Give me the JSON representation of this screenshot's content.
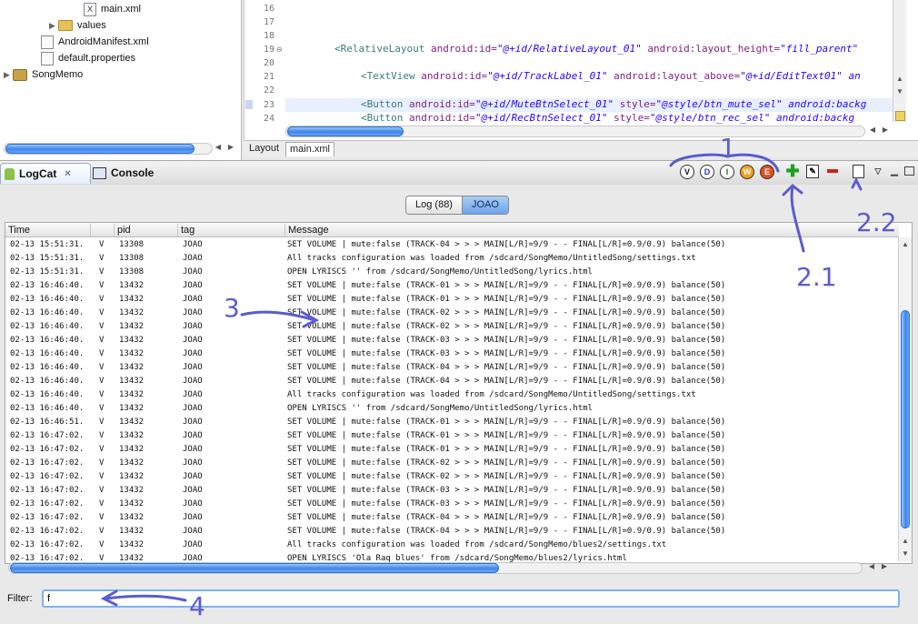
{
  "tree": {
    "items": [
      {
        "label": "main.xml",
        "kind": "file"
      },
      {
        "label": "values",
        "kind": "folder"
      },
      {
        "label": "AndroidManifest.xml",
        "kind": "file"
      },
      {
        "label": "default.properties",
        "kind": "file"
      },
      {
        "label": "SongMemo",
        "kind": "project"
      }
    ]
  },
  "editor": {
    "lines": [
      {
        "num": "16",
        "code": ""
      },
      {
        "num": "17",
        "code": ""
      },
      {
        "num": "18",
        "code": ""
      },
      {
        "num": "19",
        "tag": "<RelativeLayout",
        "a1": " android:id=",
        "v1": "\"@+id/RelativeLayout_01\"",
        "a2": " android:layout_height=",
        "v2": "\"fill_parent\""
      },
      {
        "num": "20",
        "code": ""
      },
      {
        "num": "21",
        "tag": "<TextView",
        "a1": " android:id=",
        "v1": "\"@+id/TrackLabel_01\"",
        "a2": " android:layout_above=",
        "v2": "\"@+id/EditText01\" an"
      },
      {
        "num": "22",
        "code": ""
      },
      {
        "num": "23",
        "tag": "<Button",
        "a1": " android:id=",
        "v1": "\"@+id/MuteBtnSelect_01\"",
        "a2": " style=",
        "v2": "\"@style/btn_mute_sel\" android:backg"
      },
      {
        "num": "24",
        "tag": "<Button",
        "a1": " android:id=",
        "v1": "\"@+id/RecBtnSelect_01\"",
        "a2": "  style=",
        "v2": "\"@style/btn_rec_sel\"  android:backg"
      }
    ],
    "tabs": [
      "Layout",
      "main.xml"
    ]
  },
  "views": {
    "logcat_tab": "LogCat",
    "console_tab": "Console",
    "levels": [
      "V",
      "D",
      "I",
      "W",
      "E"
    ]
  },
  "segments": {
    "log": "Log (88)",
    "joao": "JOAO"
  },
  "table": {
    "headers": [
      "Time",
      "",
      "pid",
      "tag",
      "Message"
    ],
    "rows": [
      [
        "02-13 15:51:31.",
        "V",
        "13308",
        "JOAO",
        "SET VOLUME | mute:false (TRACK-04 > > > MAIN[L/R]=9/9 - - FINAL[L/R]=0.9/0.9) balance(50)"
      ],
      [
        "02-13 15:51:31.",
        "V",
        "13308",
        "JOAO",
        "All tracks configuration was loaded from /sdcard/SongMemo/UntitledSong/settings.txt"
      ],
      [
        "02-13 15:51:31.",
        "V",
        "13308",
        "JOAO",
        "OPEN LYRISCS '' from /sdcard/SongMemo/UntitledSong/lyrics.html"
      ],
      [
        "02-13 16:46:40.",
        "V",
        "13432",
        "JOAO",
        "SET VOLUME | mute:false (TRACK-01 > > > MAIN[L/R]=9/9 - - FINAL[L/R]=0.9/0.9) balance(50)"
      ],
      [
        "02-13 16:46:40.",
        "V",
        "13432",
        "JOAO",
        "SET VOLUME | mute:false (TRACK-01 > > > MAIN[L/R]=9/9 - - FINAL[L/R]=0.9/0.9) balance(50)"
      ],
      [
        "02-13 16:46:40.",
        "V",
        "13432",
        "JOAO",
        "SET VOLUME | mute:false (TRACK-02 > > > MAIN[L/R]=9/9 - - FINAL[L/R]=0.9/0.9) balance(50)"
      ],
      [
        "02-13 16:46:40.",
        "V",
        "13432",
        "JOAO",
        "SET VOLUME | mute:false (TRACK-02 > > > MAIN[L/R]=9/9 - - FINAL[L/R]=0.9/0.9) balance(50)"
      ],
      [
        "02-13 16:46:40.",
        "V",
        "13432",
        "JOAO",
        "SET VOLUME | mute:false (TRACK-03 > > > MAIN[L/R]=9/9 - - FINAL[L/R]=0.9/0.9) balance(50)"
      ],
      [
        "02-13 16:46:40.",
        "V",
        "13432",
        "JOAO",
        "SET VOLUME | mute:false (TRACK-03 > > > MAIN[L/R]=9/9 - - FINAL[L/R]=0.9/0.9) balance(50)"
      ],
      [
        "02-13 16:46:40.",
        "V",
        "13432",
        "JOAO",
        "SET VOLUME | mute:false (TRACK-04 > > > MAIN[L/R]=9/9 - - FINAL[L/R]=0.9/0.9) balance(50)"
      ],
      [
        "02-13 16:46:40.",
        "V",
        "13432",
        "JOAO",
        "SET VOLUME | mute:false (TRACK-04 > > > MAIN[L/R]=9/9 - - FINAL[L/R]=0.9/0.9) balance(50)"
      ],
      [
        "02-13 16:46:40.",
        "V",
        "13432",
        "JOAO",
        "All tracks configuration was loaded from /sdcard/SongMemo/UntitledSong/settings.txt"
      ],
      [
        "02-13 16:46:40.",
        "V",
        "13432",
        "JOAO",
        "OPEN LYRISCS '' from /sdcard/SongMemo/UntitledSong/lyrics.html"
      ],
      [
        "02-13 16:46:51.",
        "V",
        "13432",
        "JOAO",
        "SET VOLUME | mute:false (TRACK-01 > > > MAIN[L/R]=9/9 - - FINAL[L/R]=0.9/0.9) balance(50)"
      ],
      [
        "02-13 16:47:02.",
        "V",
        "13432",
        "JOAO",
        "SET VOLUME | mute:false (TRACK-01 > > > MAIN[L/R]=9/9 - - FINAL[L/R]=0.9/0.9) balance(50)"
      ],
      [
        "02-13 16:47:02.",
        "V",
        "13432",
        "JOAO",
        "SET VOLUME | mute:false (TRACK-01 > > > MAIN[L/R]=9/9 - - FINAL[L/R]=0.9/0.9) balance(50)"
      ],
      [
        "02-13 16:47:02.",
        "V",
        "13432",
        "JOAO",
        "SET VOLUME | mute:false (TRACK-02 > > > MAIN[L/R]=9/9 - - FINAL[L/R]=0.9/0.9) balance(50)"
      ],
      [
        "02-13 16:47:02.",
        "V",
        "13432",
        "JOAO",
        "SET VOLUME | mute:false (TRACK-02 > > > MAIN[L/R]=9/9 - - FINAL[L/R]=0.9/0.9) balance(50)"
      ],
      [
        "02-13 16:47:02.",
        "V",
        "13432",
        "JOAO",
        "SET VOLUME | mute:false (TRACK-03 > > > MAIN[L/R]=9/9 - - FINAL[L/R]=0.9/0.9) balance(50)"
      ],
      [
        "02-13 16:47:02.",
        "V",
        "13432",
        "JOAO",
        "SET VOLUME | mute:false (TRACK-03 > > > MAIN[L/R]=9/9 - - FINAL[L/R]=0.9/0.9) balance(50)"
      ],
      [
        "02-13 16:47:02.",
        "V",
        "13432",
        "JOAO",
        "SET VOLUME | mute:false (TRACK-04 > > > MAIN[L/R]=9/9 - - FINAL[L/R]=0.9/0.9) balance(50)"
      ],
      [
        "02-13 16:47:02.",
        "V",
        "13432",
        "JOAO",
        "SET VOLUME | mute:false (TRACK-04 > > > MAIN[L/R]=9/9 - - FINAL[L/R]=0.9/0.9) balance(50)"
      ],
      [
        "02-13 16:47:02.",
        "V",
        "13432",
        "JOAO",
        "All tracks configuration was loaded from /sdcard/SongMemo/blues2/settings.txt"
      ],
      [
        "02-13 16:47:02.",
        "V",
        "13432",
        "JOAO",
        "OPEN LYRISCS 'Ola Raq blues' from /sdcard/SongMemo/blues2/lyrics.html"
      ]
    ]
  },
  "filter": {
    "label": "Filter:",
    "value": "f"
  },
  "annotations": {
    "a1": "1",
    "a21": "2.1",
    "a22": "2.2",
    "a3": "3",
    "a4": "4"
  },
  "colors": {
    "accent": "#3d85e8",
    "annotation": "#5a5ccf"
  }
}
